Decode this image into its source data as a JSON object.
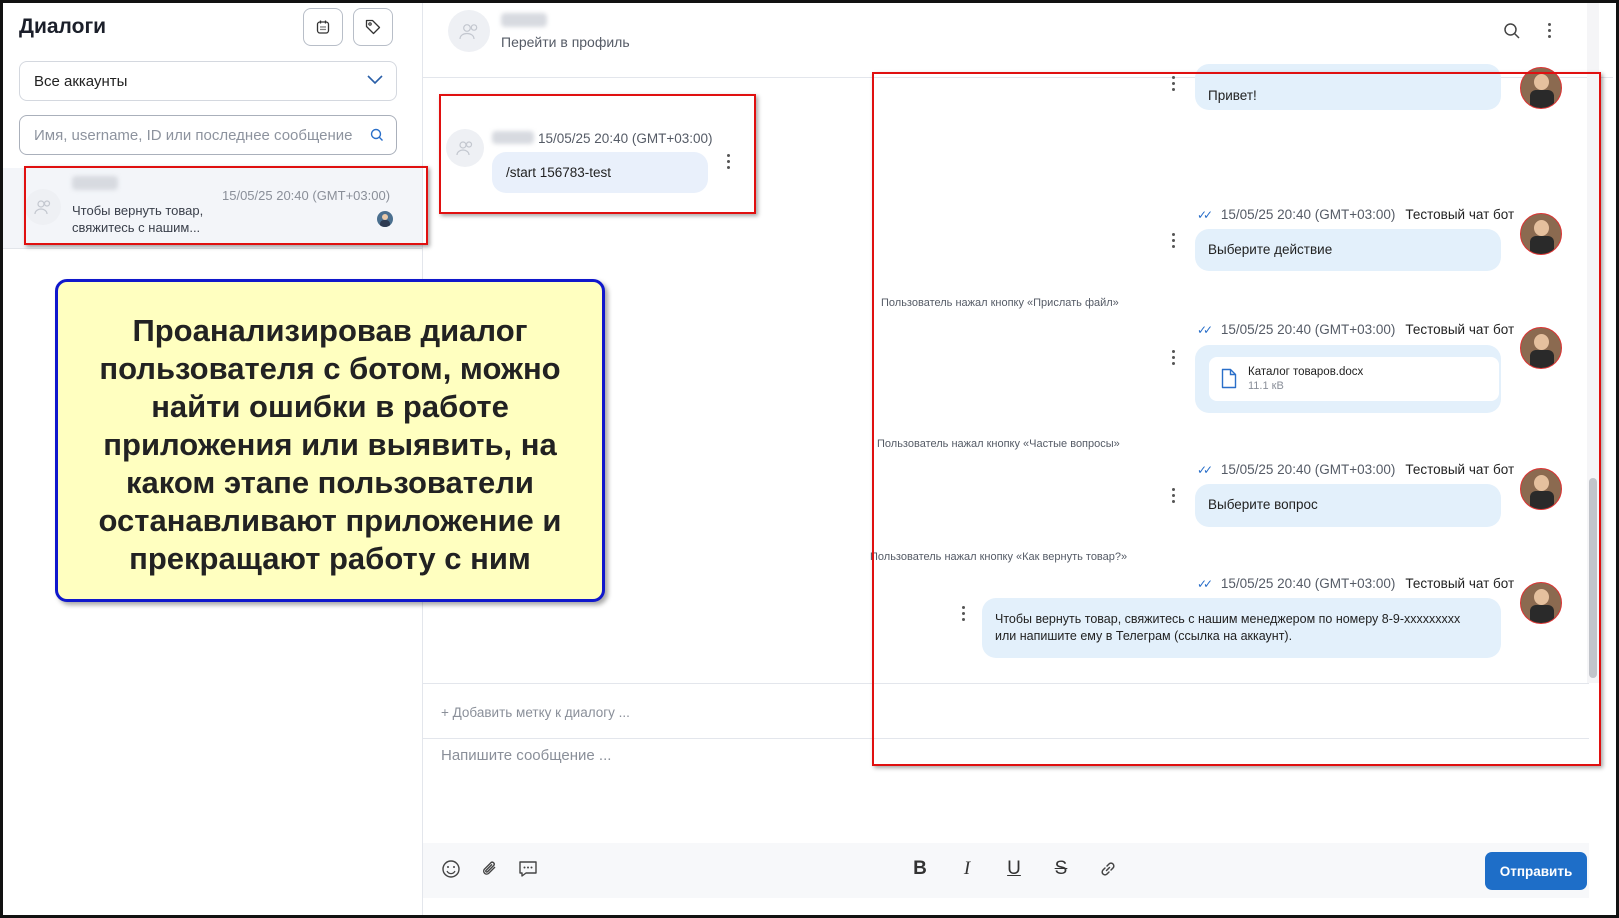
{
  "sidebar": {
    "title": "Диалоги",
    "account_select": "Все аккаунты",
    "search_placeholder": "Имя, username, ID или последнее сообщение",
    "dialog": {
      "time": "15/05/25 20:40 (GMT+03:00)",
      "last_message": "Чтобы вернуть товар, свяжитесь с нашим..."
    }
  },
  "callout": {
    "text": "Проанализировав диалог пользователя с ботом, можно найти ошибки в работе приложения или выявить, на каком этапе пользователи останавливают приложение и прекращают работу с ним"
  },
  "header": {
    "profile_link": "Перейти в профиль"
  },
  "messages": {
    "user_time": "15/05/25 20:40 (GMT+03:00)",
    "user_text": "/start 156783-test",
    "greeting": "Привет!",
    "bot_name": "Тестовый чат бот",
    "bot_time": "15/05/25 20:40 (GMT+03:00)",
    "msg_action": "Выберите действие",
    "sys_file": "Пользователь нажал кнопку «Прислать файл»",
    "file_name": "Каталог товаров.docx",
    "file_size": "11.1 кВ",
    "sys_faq": "Пользователь нажал кнопку «Частые вопросы»",
    "msg_question": "Выберите вопрос",
    "sys_return": "Пользователь нажал кнопку «Как вернуть товар?»",
    "msg_return_1": "Чтобы вернуть товар, свяжитесь с нашим менеджером по номеру 8-9-xxxxxxxxx",
    "msg_return_2": "или напишите ему в Телеграм (ссылка на аккаунт)."
  },
  "composer": {
    "add_tag": "+ Добавить метку к диалогу ...",
    "placeholder": "Напишите сообщение ...",
    "send_label": "Отправить"
  },
  "colors": {
    "accent": "#1e6ec8",
    "highlight_box": "#e01010",
    "callout_bg": "#ffffc0",
    "callout_border": "#1018cc"
  }
}
